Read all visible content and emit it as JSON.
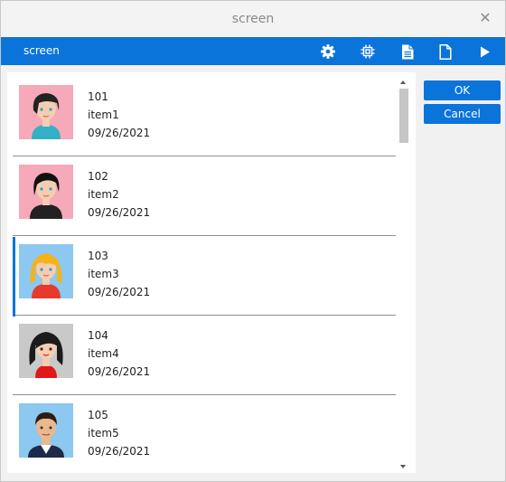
{
  "window": {
    "title": "screen"
  },
  "toolbar": {
    "title": "screen",
    "icons": [
      "gear-icon",
      "chip-icon",
      "document-text-icon",
      "document-icon",
      "play-icon"
    ]
  },
  "list": {
    "selected_index": 2,
    "items": [
      {
        "id": "101",
        "name": "item1",
        "date": "09/26/2021",
        "avatar_bg": "#f6a9b8"
      },
      {
        "id": "102",
        "name": "item2",
        "date": "09/26/2021",
        "avatar_bg": "#f6a9b8"
      },
      {
        "id": "103",
        "name": "item3",
        "date": "09/26/2021",
        "avatar_bg": "#8cc8ef"
      },
      {
        "id": "104",
        "name": "item4",
        "date": "09/26/2021",
        "avatar_bg": "#c9c9c9"
      },
      {
        "id": "105",
        "name": "item5",
        "date": "09/26/2021",
        "avatar_bg": "#8cc8ef"
      }
    ]
  },
  "buttons": {
    "ok": "OK",
    "cancel": "Cancel"
  },
  "colors": {
    "accent": "#0a74da"
  }
}
